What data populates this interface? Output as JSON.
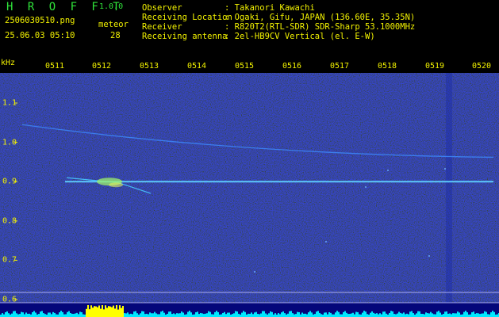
{
  "header": {
    "app_title": "H R O F F T",
    "version": "1.0.0",
    "filename": "2506030510.png",
    "datetime": "25.06.03 05:10",
    "meteor_label": "meteor",
    "meteor_count": "28",
    "info": [
      {
        "label": "Observer",
        "value": ": Takanori Kawachi"
      },
      {
        "label": "Receiving Location",
        "value": ": Ogaki, Gifu, JAPAN (136.60E, 35.35N)"
      },
      {
        "label": "Receiver",
        "value": ": R820T2(RTL-SDR) SDR-Sharp 53.1000MHz"
      },
      {
        "label": "Receiving antenna",
        "value": ": 2el-HB9CV Vertical (el. E-W)"
      }
    ]
  },
  "axes": {
    "unit_label": "kHz",
    "time_ticks": [
      "0511",
      "0512",
      "0513",
      "0514",
      "0515",
      "0516",
      "0517",
      "0518",
      "0519",
      "0520"
    ],
    "freq_ticks": [
      "1.1",
      "1.0",
      "0.9",
      "0.8",
      "0.7",
      "0.6"
    ]
  },
  "colors": {
    "label_yellow": "#f2f200",
    "header_green": "#2fe23a",
    "waterfall_bg": "#04067a",
    "signal_line": "#5fd0ff",
    "level_cyan": "#00e8ff",
    "level_yellow": "#ffff00"
  },
  "waterfall": {
    "carrier_khz": 0.9,
    "meteor_echoes": 28
  }
}
